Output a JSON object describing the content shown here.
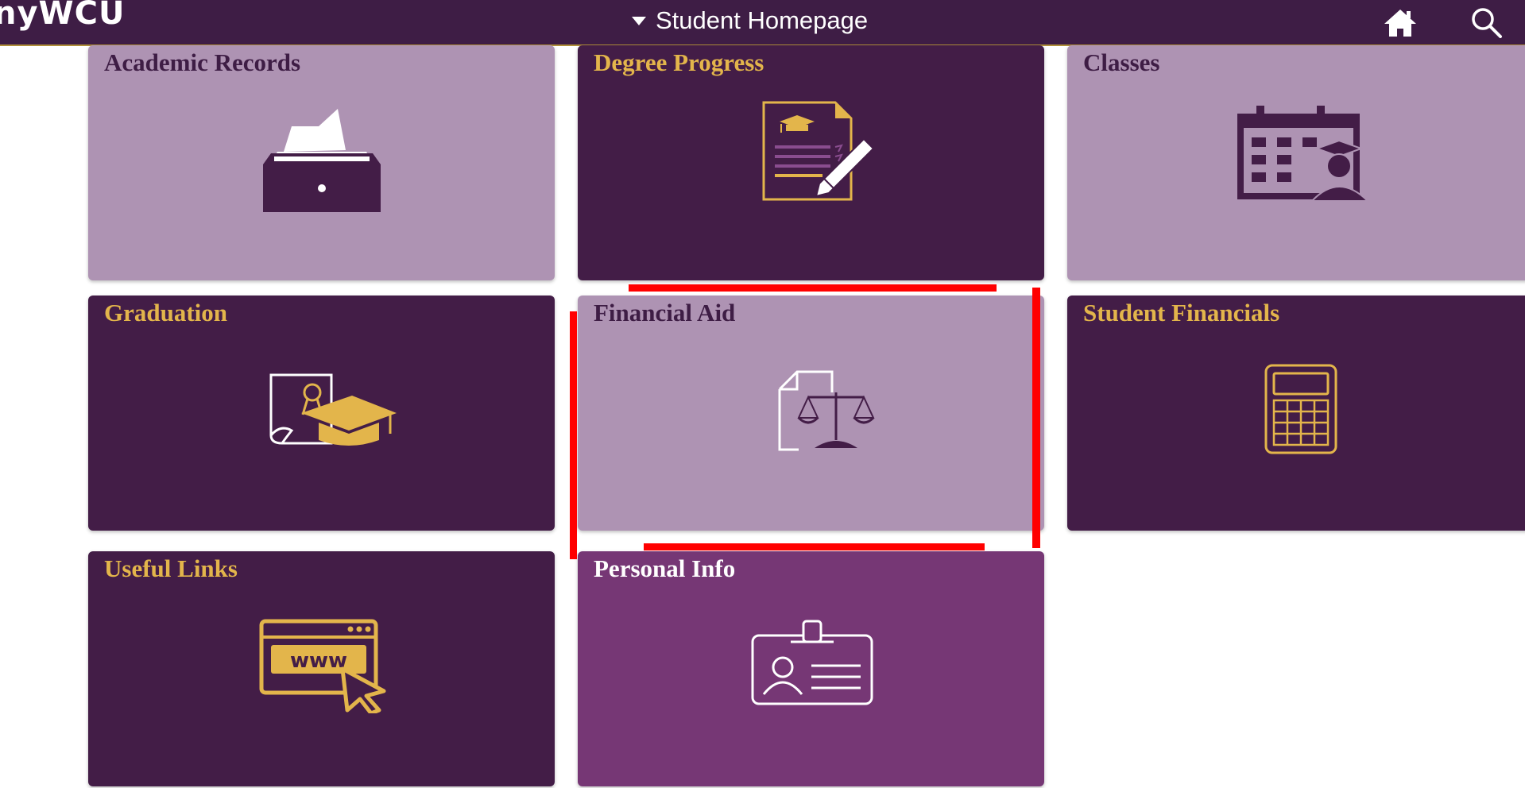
{
  "header": {
    "logo_text": "nyWCU",
    "page_title": "Student Homepage"
  },
  "icons": {
    "home": "home-icon",
    "search": "search-icon",
    "dropdown": "caret-down-icon"
  },
  "tiles": [
    {
      "title": "Academic Records",
      "icon": "file-drawer-icon",
      "style": "light"
    },
    {
      "title": "Degree Progress",
      "icon": "degree-document-icon",
      "style": "dark"
    },
    {
      "title": "Classes",
      "icon": "calendar-student-icon",
      "style": "light"
    },
    {
      "title": "Graduation",
      "icon": "diploma-cap-icon",
      "style": "dark"
    },
    {
      "title": "Financial Aid",
      "icon": "document-scales-icon",
      "style": "light"
    },
    {
      "title": "Student Financials",
      "icon": "calculator-icon",
      "style": "dark"
    },
    {
      "title": "Useful Links",
      "icon": "www-cursor-icon",
      "style": "dark"
    },
    {
      "title": "Personal Info",
      "icon": "id-badge-icon",
      "style": "mid"
    }
  ],
  "colors": {
    "header_bg": "#3e1d45",
    "tile_light": "#ae93b3",
    "tile_dark": "#431d47",
    "tile_mid": "#763775",
    "gold": "#e3b54b",
    "highlight": "#ff0000"
  },
  "annotation": {
    "highlighted_tile": "Financial Aid"
  }
}
